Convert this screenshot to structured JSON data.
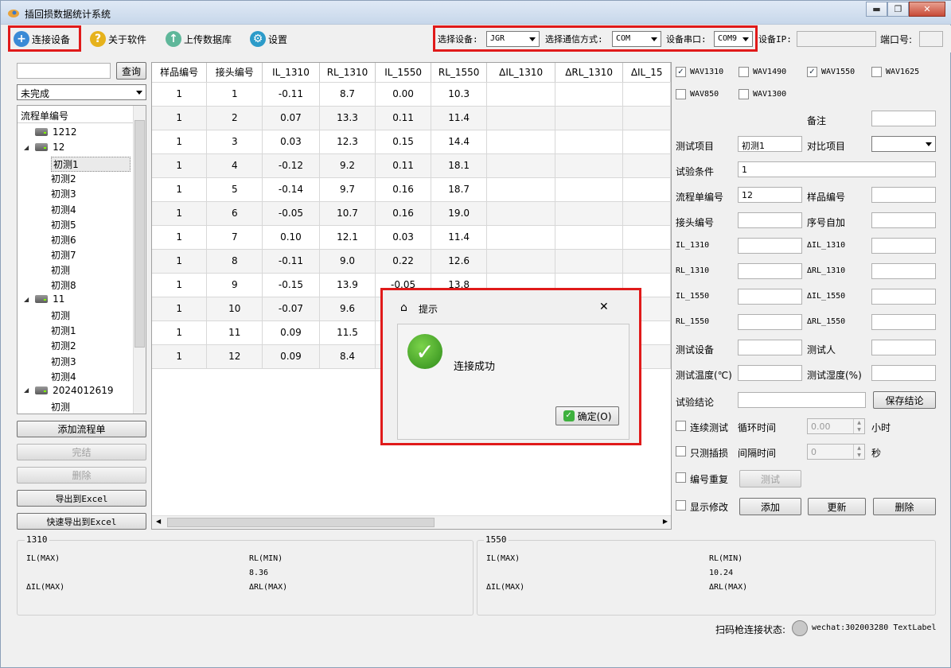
{
  "window": {
    "title": "插回损数据统计系统"
  },
  "toolbar": {
    "connect": "连接设备",
    "about": "关于软件",
    "upload": "上传数据库",
    "settings": "设置",
    "device_label": "选择设备:",
    "device_value": "JGR",
    "comm_label": "选择通信方式:",
    "comm_value": "COM",
    "port_label": "设备串口:",
    "port_value": "COM9",
    "ip_label": "设备IP:",
    "portno_label": "端口号:"
  },
  "left": {
    "query": "查询",
    "filter": "未完成",
    "tree_header": "流程单编号",
    "nodes": [
      {
        "label": "1212"
      },
      {
        "label": "12"
      },
      {
        "label": "初测1"
      },
      {
        "label": "初测2"
      },
      {
        "label": "初测3"
      },
      {
        "label": "初测4"
      },
      {
        "label": "初测5"
      },
      {
        "label": "初测6"
      },
      {
        "label": "初测7"
      },
      {
        "label": "初测"
      },
      {
        "label": "初测8"
      },
      {
        "label": "11"
      },
      {
        "label": "初测"
      },
      {
        "label": "初测1"
      },
      {
        "label": "初测2"
      },
      {
        "label": "初测3"
      },
      {
        "label": "初测4"
      },
      {
        "label": "2024012619"
      },
      {
        "label": "初测"
      }
    ],
    "add_flow": "添加流程单",
    "finish": "完结",
    "delete": "删除",
    "export": "导出到Excel",
    "fast_export": "快速导出到Excel"
  },
  "grid": {
    "headers": [
      "样品编号",
      "接头编号",
      "IL_1310",
      "RL_1310",
      "IL_1550",
      "RL_1550",
      "ΔIL_1310",
      "ΔRL_1310",
      "ΔIL_15"
    ],
    "rows": [
      [
        "1",
        "1",
        "-0.11",
        "8.7",
        "0.00",
        "10.3"
      ],
      [
        "1",
        "2",
        "0.07",
        "13.3",
        "0.11",
        "11.4"
      ],
      [
        "1",
        "3",
        "0.03",
        "12.3",
        "0.15",
        "14.4"
      ],
      [
        "1",
        "4",
        "-0.12",
        "9.2",
        "0.11",
        "18.1"
      ],
      [
        "1",
        "5",
        "-0.14",
        "9.7",
        "0.16",
        "18.7"
      ],
      [
        "1",
        "6",
        "-0.05",
        "10.7",
        "0.16",
        "19.0"
      ],
      [
        "1",
        "7",
        "0.10",
        "12.1",
        "0.03",
        "11.4"
      ],
      [
        "1",
        "8",
        "-0.11",
        "9.0",
        "0.22",
        "12.6"
      ],
      [
        "1",
        "9",
        "-0.15",
        "13.9",
        "-0.05",
        "13.8"
      ],
      [
        "1",
        "10",
        "-0.07",
        "9.6",
        "",
        ""
      ],
      [
        "1",
        "11",
        "0.09",
        "11.5",
        "",
        ""
      ],
      [
        "1",
        "12",
        "0.09",
        "8.4",
        "",
        ""
      ]
    ]
  },
  "right": {
    "wav1310": "WAV1310",
    "wav1490": "WAV1490",
    "wav1550": "WAV1550",
    "wav1625": "WAV1625",
    "wav850": "WAV850",
    "wav1300": "WAV1300",
    "remark": "备注",
    "test_item": "测试项目",
    "test_item_value": "初测1",
    "compare_item": "对比项目",
    "condition": "试验条件",
    "condition_value": "1",
    "flow_no": "流程单编号",
    "flow_no_value": "12",
    "sample_no": "样品编号",
    "conn_no": "接头编号",
    "seq_auto": "序号自加",
    "il1310": "IL_1310",
    "dil1310": "ΔIL_1310",
    "rl1310": "RL_1310",
    "drl1310": "ΔRL_1310",
    "il1550": "IL_1550",
    "dil1550": "ΔIL_1550",
    "rl1550": "RL_1550",
    "drl1550": "ΔRL_1550",
    "device": "测试设备",
    "tester": "测试人",
    "temp": "测试温度(℃)",
    "humidity": "测试湿度(%)",
    "conclusion": "试验结论",
    "save_conclusion": "保存结论",
    "continuous": "连续测试",
    "cycle_time": "循环时间",
    "cycle_value": "0.00",
    "hours": "小时",
    "only_il": "只测插损",
    "interval": "间隔时间",
    "interval_value": "0",
    "seconds": "秒",
    "repeat_no": "编号重复",
    "test_btn": "测试",
    "show_edit": "显示修改",
    "add": "添加",
    "update": "更新",
    "del": "删除"
  },
  "bottom": {
    "g1310": "1310",
    "g1550": "1550",
    "il_max": "IL(MAX)",
    "rl_min": "RL(MIN)",
    "dil_max": "ΔIL(MAX)",
    "drl_max": "ΔRL(MAX)",
    "rl_min_1310": "8.36",
    "rl_min_1550": "10.24"
  },
  "status": {
    "scanner": "扫码枪连接状态:",
    "wechat": "wechat:302003280 TextLabel"
  },
  "dialog": {
    "title": "提示",
    "message": "连接成功",
    "ok": "确定(O)"
  }
}
